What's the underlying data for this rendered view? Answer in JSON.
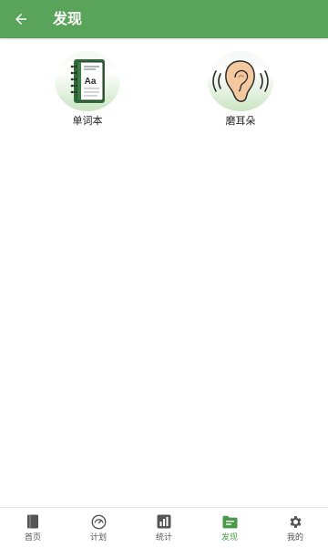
{
  "header": {
    "title": "发现",
    "back_icon": "arrow-left-icon"
  },
  "features": [
    {
      "label": "单词本",
      "icon": "notebook-icon"
    },
    {
      "label": "磨耳朵",
      "icon": "ear-icon"
    }
  ],
  "bottom_nav": {
    "items": [
      {
        "label": "首页",
        "icon": "book-icon",
        "active": false
      },
      {
        "label": "计划",
        "icon": "gauge-icon",
        "active": false
      },
      {
        "label": "统计",
        "icon": "bar-chart-icon",
        "active": false
      },
      {
        "label": "发现",
        "icon": "discover-icon",
        "active": true
      },
      {
        "label": "我的",
        "icon": "gear-icon",
        "active": false
      }
    ]
  },
  "colors": {
    "primary": "#5aa35a",
    "active_tab": "#4a9a4a",
    "inactive_tab": "#555555"
  }
}
